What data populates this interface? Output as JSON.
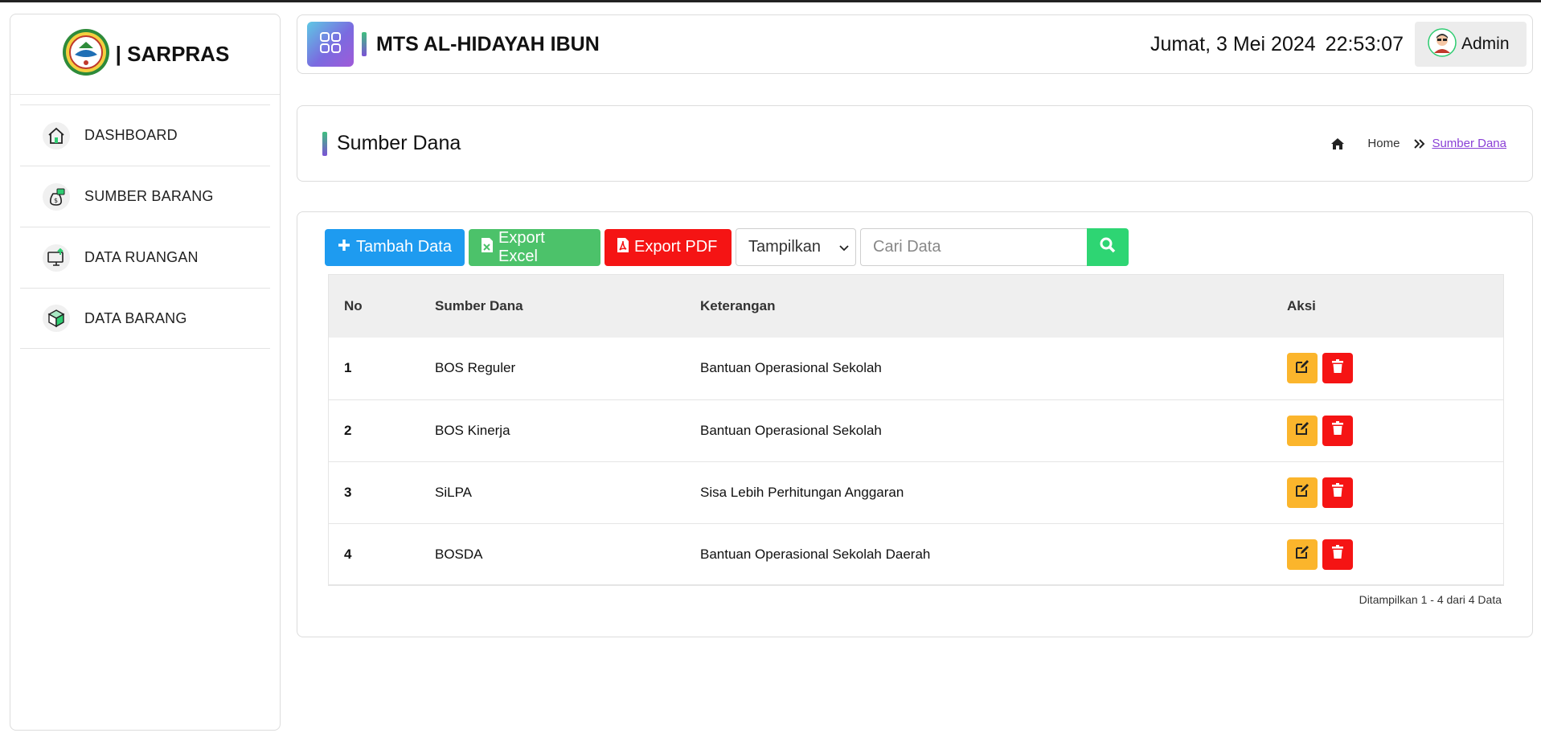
{
  "sidebar": {
    "brand": "| SARPRAS",
    "items": [
      {
        "label": "DASHBOARD",
        "icon": "home-icon"
      },
      {
        "label": "SUMBER BARANG",
        "icon": "money-bag-icon"
      },
      {
        "label": "DATA RUANGAN",
        "icon": "monitor-upload-icon"
      },
      {
        "label": "DATA BARANG",
        "icon": "box-icon"
      }
    ]
  },
  "topbar": {
    "school_name": "MTS AL-HIDAYAH IBUN",
    "date": "Jumat, 3 Mei 2024",
    "time": "22:53:07",
    "user": "Admin"
  },
  "page": {
    "title": "Sumber Dana",
    "breadcrumb_home": "Home",
    "breadcrumb_current": "Sumber Dana"
  },
  "toolbar": {
    "add_label": "Tambah Data",
    "excel_label": "Export Excel",
    "pdf_label": "Export PDF",
    "select_value": "Tampilkan",
    "search_placeholder": "Cari Data"
  },
  "table": {
    "headers": {
      "no": "No",
      "sumber": "Sumber Dana",
      "ket": "Keterangan",
      "aksi": "Aksi"
    },
    "rows": [
      {
        "no": "1",
        "sumber": "BOS Reguler",
        "ket": "Bantuan Operasional Sekolah"
      },
      {
        "no": "2",
        "sumber": "BOS Kinerja",
        "ket": "Bantuan Operasional Sekolah"
      },
      {
        "no": "3",
        "sumber": "SiLPA",
        "ket": "Sisa Lebih Perhitungan Anggaran"
      },
      {
        "no": "4",
        "sumber": "BOSDA",
        "ket": "Bantuan Operasional Sekolah Daerah"
      }
    ],
    "footer": "Ditampilkan 1 - 4 dari 4 Data"
  },
  "colors": {
    "primary": "#1e9bf0",
    "excel": "#4cc26a",
    "danger": "#f51414",
    "warning": "#fbb52c",
    "search": "#2ed573",
    "accent_purple": "#8a3fd6"
  }
}
